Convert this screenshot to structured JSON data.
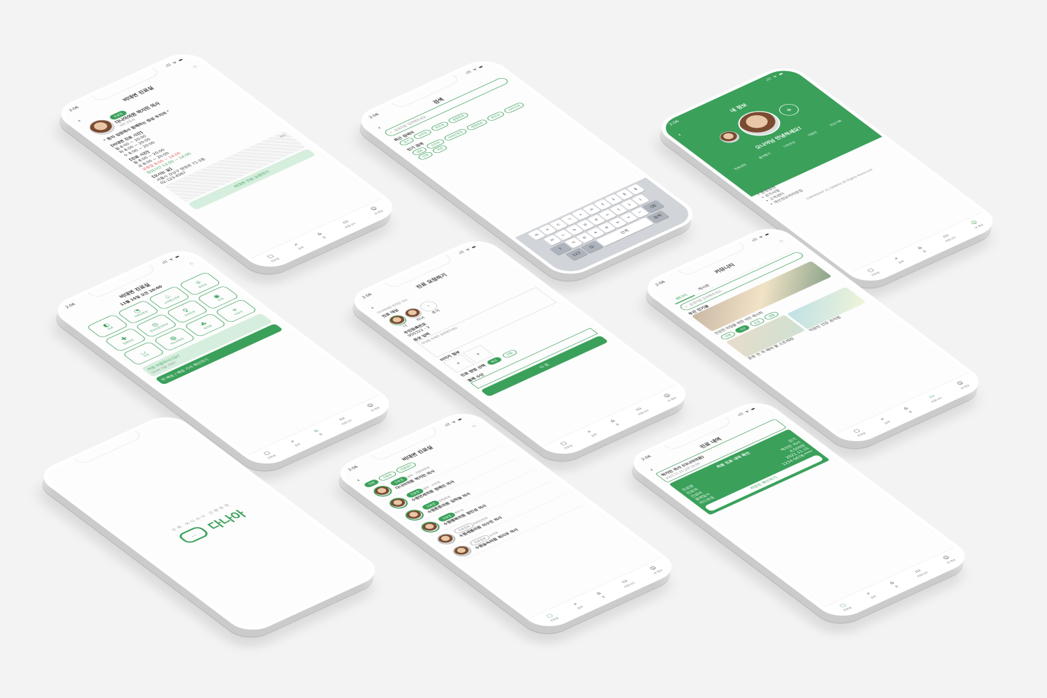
{
  "status": {
    "time": "2:06",
    "signal": "ıll ᯤ ▬"
  },
  "tabbar": [
    {
      "label": "진료실",
      "icon": "clinic-icon"
    },
    {
      "label": "검색",
      "icon": "search-icon"
    },
    {
      "label": "홈",
      "icon": "home-icon"
    },
    {
      "label": "커뮤니티",
      "icon": "chat-icon"
    },
    {
      "label": "내 정보",
      "icon": "user-icon"
    }
  ],
  "screen_clinic_detail": {
    "title": "비대면 진료실",
    "badge": "진료중",
    "hospital": "다나아의원",
    "doctor": "박지민 의사",
    "doctor_sub": "내과 전문의",
    "quote": "\" 환자 입장에서 함께하는 정성 주치의 \"",
    "section1_title": "[비대면 진료 시간]",
    "section1_lines": [
      "월 8:00 ~ 20:00",
      "화 8:00 ~ 20:00",
      "수 8:00 ~ 20:00",
      "목 8:00 ~ 20:00"
    ],
    "section2_title": "[진료 시간]",
    "section2_lines": [
      "월 8:00 ~ 20:00",
      "금 8:00 ~ 20:00",
      "토 8:00 ~ 20:00"
    ],
    "holiday": "공휴일 8:00 ~ 14:00",
    "lunch": "점심시간 13:00 ~ 14:00",
    "location_title": "[오시는 길]",
    "address": "서울시 강남구 땅땅로 71-3층",
    "phone": "02-123-4567",
    "map_label": "위치",
    "cta": "비대면 진료 요청하기"
  },
  "screen_search": {
    "title": "검색",
    "placeholder": "검색어를 입력해주세요.",
    "recent_title": "최근 검색어",
    "recent": [
      "감기",
      "소아과",
      "피부과",
      "정형외과"
    ],
    "popular_title": "인기 검색",
    "popular": [
      "내과",
      "소아과",
      "이비인후과",
      "정형외과",
      "피부과",
      "산부인과",
      "안과",
      "치과"
    ],
    "kbd_rows": [
      [
        "ㅂ",
        "ㅈ",
        "ㄷ",
        "ㄱ",
        "ㅅ",
        "ㅛ",
        "ㅕ",
        "ㅑ",
        "ㅐ",
        "ㅔ"
      ],
      [
        "ㅁ",
        "ㄴ",
        "ㅇ",
        "ㄹ",
        "ㅎ",
        "ㅗ",
        "ㅓ",
        "ㅏ",
        "ㅣ"
      ],
      [
        "ㅋ",
        "ㅌ",
        "ㅊ",
        "ㅍ",
        "ㅠ",
        "ㅜ",
        "ㅡ"
      ]
    ],
    "kbd_num": "123",
    "kbd_space": "간격",
    "kbd_search": "검색"
  },
  "screen_profile": {
    "title": "내 정보",
    "greeting": "오나야님 안녕하세요!",
    "menu": [
      "진료내역",
      "즐겨찾기",
      "나의건강",
      "처방전",
      "건강기록"
    ],
    "links": [
      "• 환경설정",
      "• 공지사항",
      "• 고객센터",
      "• 개인정보처리방침"
    ],
    "footer": "COPYRIGHT (C) DANAA All Rights Reserved."
  },
  "screen_home": {
    "title": "비대면 진료실",
    "date": "11월 15일 오전 10:00",
    "categories": [
      "내과",
      "이비인후과",
      "소아청소년과",
      "피부과",
      "정형외과",
      "정신건강의학과",
      "산부인과",
      "안과",
      "치과",
      "비뇨의학과",
      "한의원",
      "더보기"
    ],
    "banner1": "처음 이용하시나요?",
    "banner1_sub": "다나아 이용 가이드",
    "banner2": "약 배송 / 배송 기사 확인하기"
  },
  "screen_request": {
    "title": "진료 요청하기",
    "hospital": "다나아의원 박지민 의사",
    "patient_label": "진료 대상",
    "patients": [
      "나",
      "자녀"
    ],
    "add_label": "추가",
    "rrn_label": "주민등록번호",
    "rrn_value": "950322 - 2",
    "symptom_label": "증상 입력",
    "symptom_placeholder": "증상을 자세히 입력해주세요.",
    "photo_label": "이미지 첨부",
    "method_label": "진료 방법 선택",
    "methods": [
      "화상",
      "전화"
    ],
    "pay_label": "결제 수단",
    "cta": "다 음"
  },
  "screen_community": {
    "title": "커뮤니티",
    "tabs": [
      "에디터",
      "게시판"
    ],
    "search_placeholder": "검색어를 입력해주세요.",
    "popular": "주간 인기글",
    "post1": "건강한 아침을 위한 식단 레시피",
    "chips": [
      "전체",
      "식단",
      "운동",
      "생활"
    ],
    "post2": "운동 전 꼭 해야 할 스트레칭",
    "post3": "직장인 건강 관리법"
  },
  "screen_splash": {
    "tagline": "언제 어디서나 간편하게",
    "brand": "다나아",
    "bubble": "..."
  },
  "screen_list": {
    "title": "비대면 진료실",
    "filters": [
      "전체",
      "진료중",
      "진료대기"
    ],
    "doctors": [
      {
        "status": "진료중",
        "hospital": "다나아의원",
        "name": "박지민 의사",
        "sub": "내과 · 가정의학과"
      },
      {
        "status": "진료중",
        "hospital": "수원연세의원",
        "name": "정재인 의사",
        "sub": "내과 · 소아과"
      },
      {
        "status": "진료중",
        "hospital": "수원튼튼의원",
        "name": "김하늘 의사",
        "sub": "정형외과"
      },
      {
        "status": "진료중",
        "hospital": "수원행복의원",
        "name": "정민성 의사",
        "sub": "피부과"
      },
      {
        "status": "진료종료",
        "hospital": "수원새봄의원",
        "name": "이수민 의사",
        "sub": "이비인후과"
      },
      {
        "status": "진료종료",
        "hospital": "수원숲속의원",
        "name": "최지우 의사",
        "sub": "소아과"
      }
    ]
  },
  "screen_history": {
    "title": "진료 내역",
    "item_title": "박지민 의사 (다나아의원)",
    "item_date": "2021.11.15 오전 10:00",
    "card_title": "최종 진료 내역 확인",
    "rows": [
      {
        "k": "진료명",
        "v": "감기"
      },
      {
        "k": "진료의",
        "v": "박지민 의사"
      },
      {
        "k": "진료비",
        "v": "4,500원"
      },
      {
        "k": "결제일시",
        "v": "2021.11.15"
      },
      {
        "k": "카드번호",
        "v": "1234-5678-****"
      }
    ],
    "card_btn": "처방전 확인하기"
  }
}
